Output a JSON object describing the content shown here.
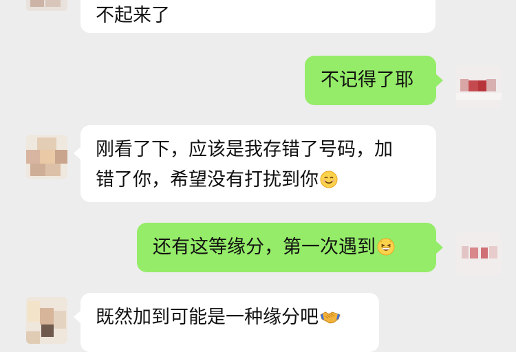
{
  "messages": [
    {
      "side": "in",
      "text": "不起来了"
    },
    {
      "side": "out",
      "text": "不记得了耶"
    },
    {
      "side": "in",
      "line1": "刚看了下，应该是我存错了号码，加",
      "line2": "错了你，希望没有打扰到你",
      "emoji": "smiling-face-emoji"
    },
    {
      "side": "out",
      "text": "还有这等缘分，第一次遇到",
      "emoji": "grinning-face-emoji"
    },
    {
      "side": "in",
      "text": "既然加到可能是一种缘分吧",
      "emoji": "handshake-emoji"
    }
  ],
  "colors": {
    "background": "#ededed",
    "incoming_bubble": "#ffffff",
    "outgoing_bubble": "#95ec69",
    "text": "#111111"
  }
}
